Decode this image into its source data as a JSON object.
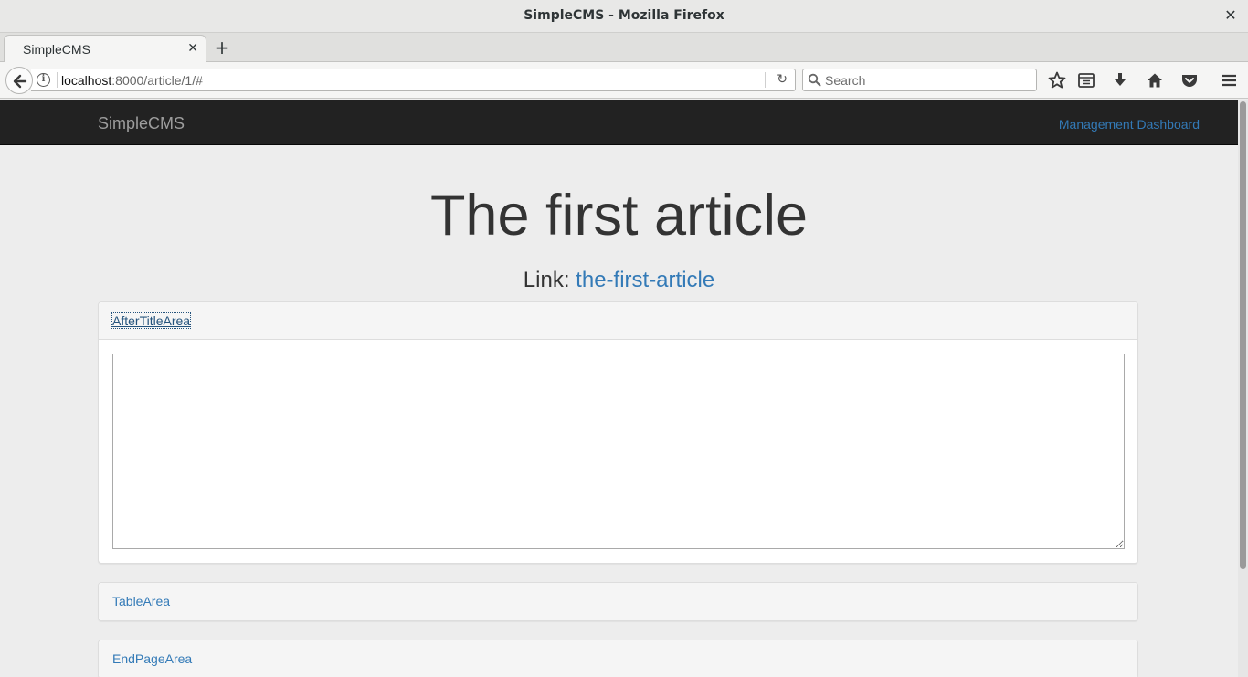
{
  "window": {
    "title": "SimpleCMS - Mozilla Firefox"
  },
  "tabs": [
    {
      "label": "SimpleCMS"
    }
  ],
  "urlbar": {
    "host": "localhost",
    "path": ":8000/article/1/#"
  },
  "search": {
    "placeholder": "Search"
  },
  "site": {
    "brand": "SimpleCMS",
    "dashboard_link": "Management Dashboard"
  },
  "article": {
    "title": "The first article",
    "link_label": "Link:",
    "link_slug": "the-first-article"
  },
  "panels": [
    {
      "title": "AfterTitleArea",
      "content": ""
    },
    {
      "title": "TableArea"
    },
    {
      "title": "EndPageArea"
    }
  ]
}
